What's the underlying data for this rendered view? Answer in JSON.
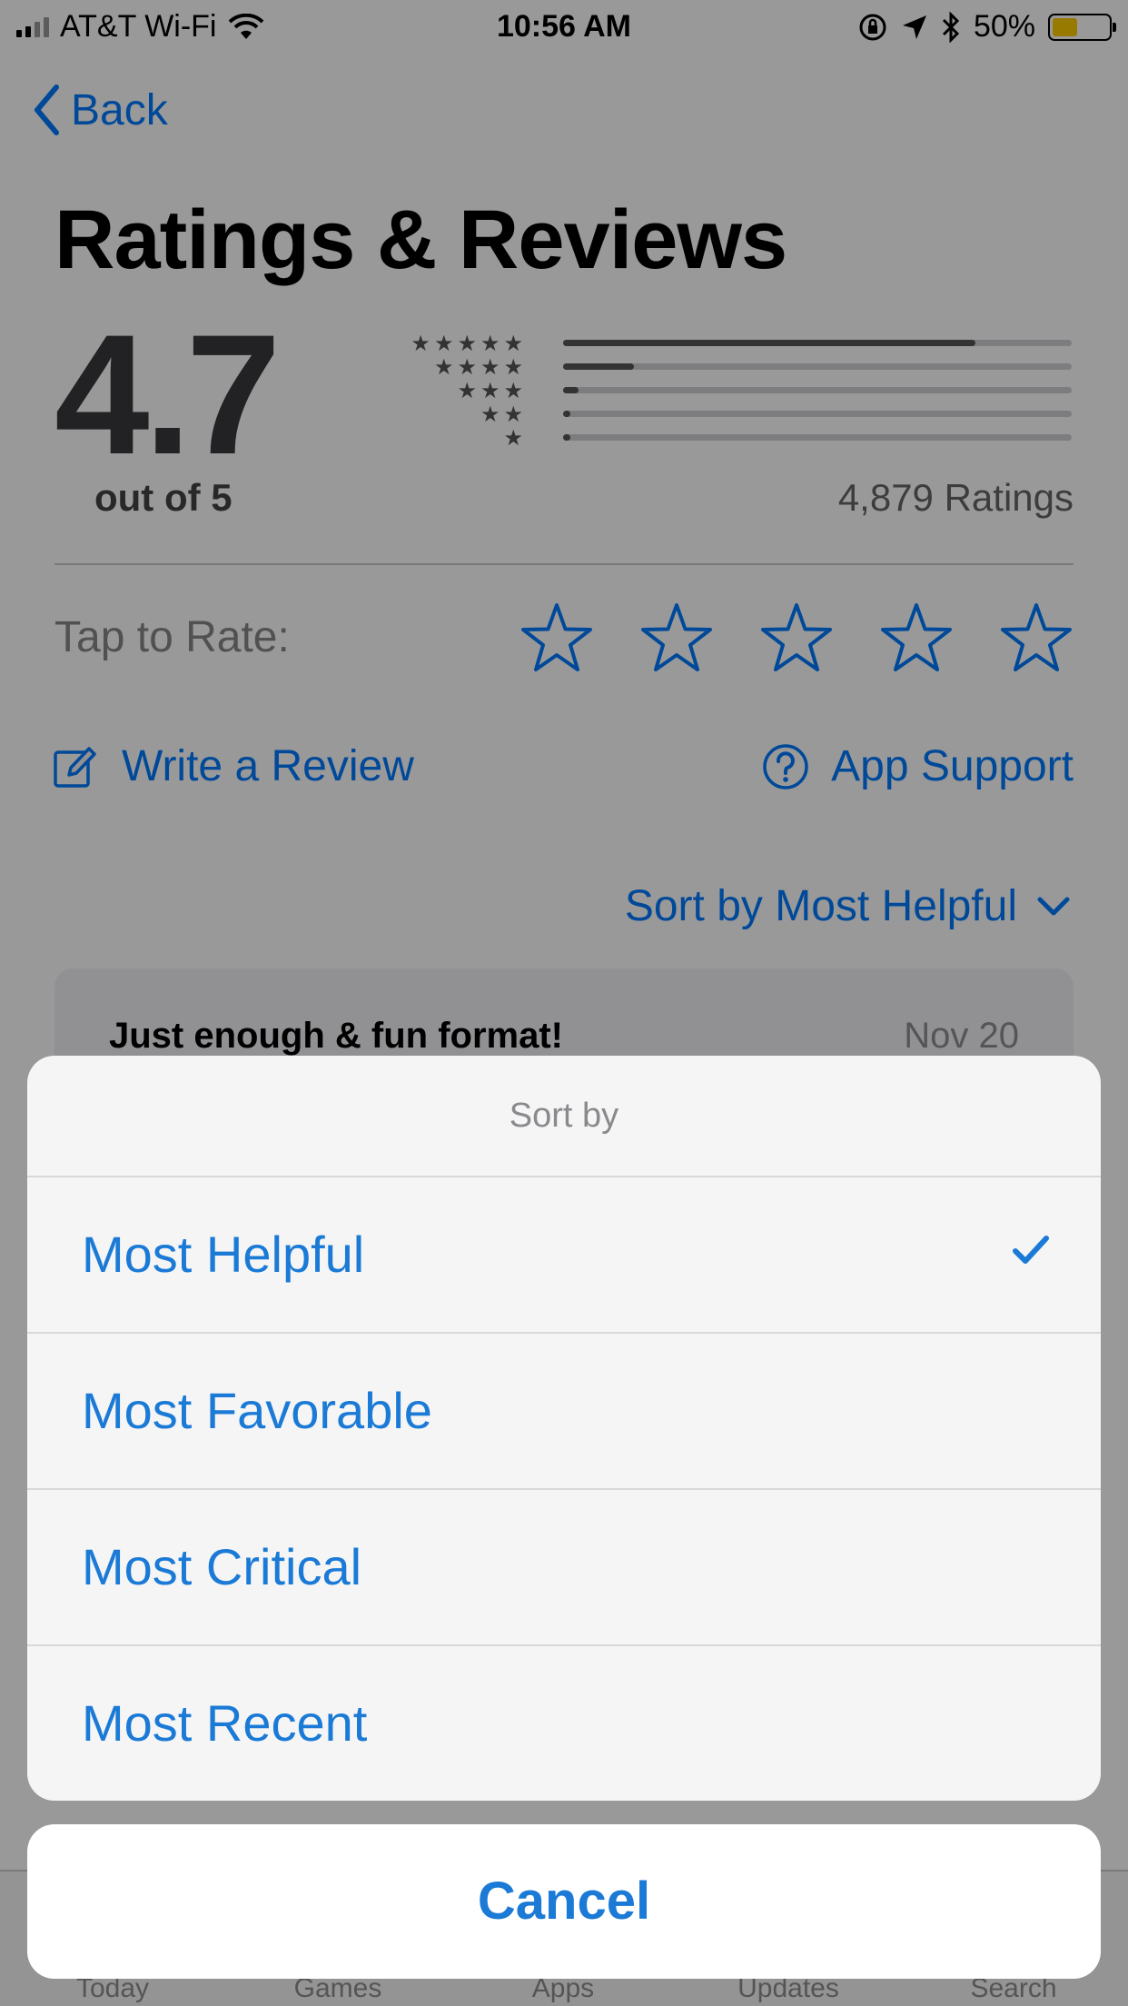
{
  "status_bar": {
    "carrier": "AT&T Wi-Fi",
    "time": "10:56 AM",
    "battery": "50%",
    "battery_level": 0.5
  },
  "nav": {
    "back_label": "Back"
  },
  "page": {
    "title": "Ratings & Reviews"
  },
  "rating": {
    "score": "4.7",
    "out_of": "out of 5",
    "count_label": "4,879 Ratings",
    "distribution": [
      {
        "stars": "★★★★★",
        "fraction": 0.81
      },
      {
        "stars": "★★★★",
        "fraction": 0.14
      },
      {
        "stars": "★★★",
        "fraction": 0.03
      },
      {
        "stars": "★★",
        "fraction": 0.01
      },
      {
        "stars": "★",
        "fraction": 0.015
      }
    ]
  },
  "rate": {
    "label": "Tap to Rate:"
  },
  "actions": {
    "write_review": "Write a Review",
    "app_support": "App Support"
  },
  "sort": {
    "label": "Sort by Most Helpful"
  },
  "review": {
    "title": "Just enough & fun format!",
    "date": "Nov 20"
  },
  "tabs": [
    {
      "label": "Today"
    },
    {
      "label": "Games"
    },
    {
      "label": "Apps"
    },
    {
      "label": "Updates"
    },
    {
      "label": "Search"
    }
  ],
  "action_sheet": {
    "title": "Sort by",
    "options": [
      {
        "label": "Most Helpful",
        "selected": true
      },
      {
        "label": "Most Favorable",
        "selected": false
      },
      {
        "label": "Most Critical",
        "selected": false
      },
      {
        "label": "Most Recent",
        "selected": false
      }
    ],
    "cancel": "Cancel"
  },
  "colors": {
    "accent": "#007aff",
    "sheet_text": "#1a7ad6",
    "battery_fill": "#ffcc00"
  }
}
